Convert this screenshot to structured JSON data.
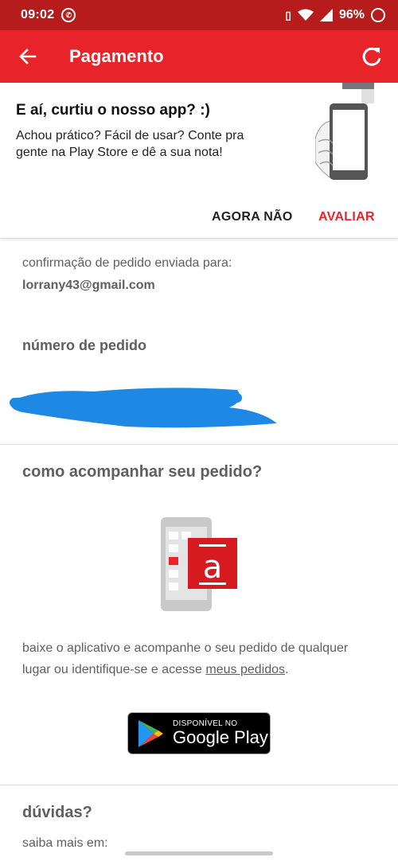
{
  "status_bar": {
    "time": "09:02",
    "battery": "96%"
  },
  "app_bar": {
    "title": "Pagamento",
    "back_icon": "arrow-left-icon",
    "refresh_icon": "refresh-icon"
  },
  "rating_card": {
    "title": "E aí, curtiu o nosso app? :)",
    "body": "Achou prático? Fácil de usar? Conte pra gente na Play Store e dê a sua nota!",
    "dismiss_label": "AGORA NÃO",
    "rate_label": "AVALIAR"
  },
  "confirmation": {
    "label": "confirmação de pedido enviada para:",
    "email": "lorrany43@gmail.com"
  },
  "order": {
    "label": "número de pedido"
  },
  "tracking": {
    "title": "como acompanhar seu pedido?",
    "text_before_link": "baixe o aplicativo e acompanhe o seu pedido de qualquer lugar ou identifique-se e acesse ",
    "link_label": "meus pedidos",
    "text_after_link": "."
  },
  "google_play": {
    "small_label": "DISPONÍVEL NO",
    "big_label": "Google Play"
  },
  "faq": {
    "title": "dúvidas?",
    "text": "saiba mais em:"
  },
  "colors": {
    "status_bar": "#b71c1c",
    "app_bar": "#e8232a",
    "accent": "#e8232a",
    "redaction": "#1e88e5"
  }
}
